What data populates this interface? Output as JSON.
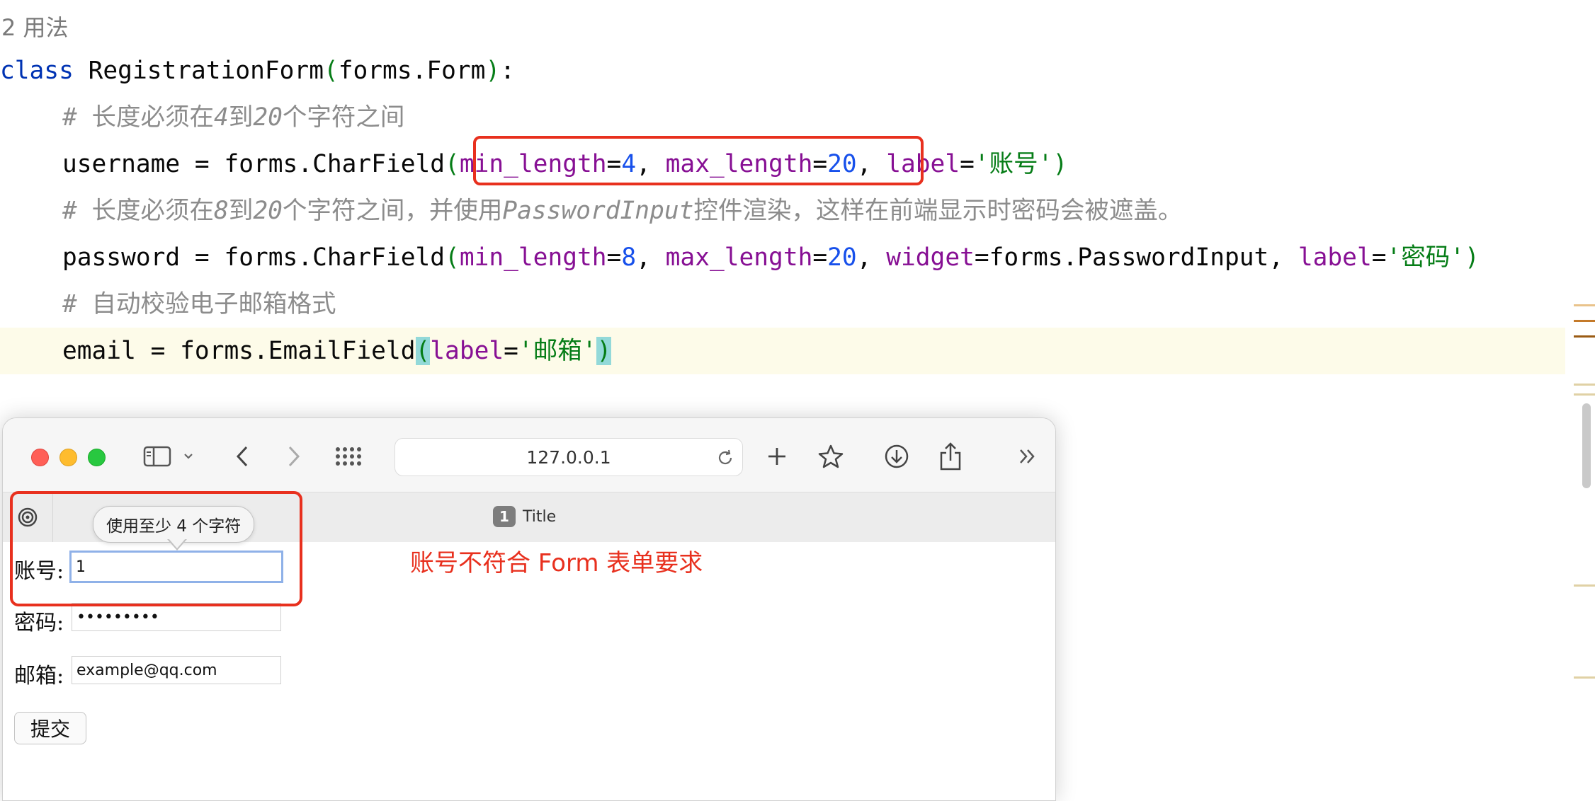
{
  "editor": {
    "usages": "2 用法",
    "line1": {
      "kw": "class",
      "name": " RegistrationForm",
      "open": "(",
      "base": "forms.Form",
      "close": ")",
      "colon": ":"
    },
    "line2": {
      "hash": "# ",
      "text_a": "长度必须在",
      "n1": "4",
      "text_b": "到",
      "n2": "20",
      "text_c": "个字符之间"
    },
    "line3": {
      "lhs": "username = forms.CharField",
      "open": "(",
      "p1": "min_length",
      "eq1": "=",
      "v1": "4",
      "sep1": ", ",
      "p2": "max_length",
      "eq2": "=",
      "v2": "20",
      "sep2": ", ",
      "p3": "label",
      "eq3": "=",
      "v3": "'账号'",
      "close": ")"
    },
    "line4": {
      "hash": "# ",
      "text_a": "长度必须在",
      "n1": "8",
      "text_b": "到",
      "n2": "20",
      "text_c": "个字符之间，并使用",
      "widget": "PasswordInput",
      "text_d": "控件渲染，这样在前端显示时密码会被遮盖。"
    },
    "line5": {
      "lhs": "password = forms.CharField",
      "open": "(",
      "p1": "min_length",
      "eq1": "=",
      "v1": "8",
      "sep1": ", ",
      "p2": "max_length",
      "eq2": "=",
      "v2": "20",
      "sep2": ", ",
      "p3": "widget",
      "eq3": "=",
      "v3": "forms.PasswordInput",
      "sep3": ", ",
      "p4": "label",
      "eq4": "=",
      "v4": "'密码'",
      "close": ")"
    },
    "line6": {
      "hash": "# ",
      "text": "自动校验电子邮箱格式"
    },
    "line7": {
      "lhs": "email = forms.EmailField",
      "open": "(",
      "p1": "label",
      "eq1": "=",
      "v1": "'邮箱'",
      "close": ")"
    }
  },
  "browser": {
    "url": "127.0.0.1",
    "tab": {
      "count": "1",
      "title": "Title"
    },
    "form": {
      "username_label": "账号:",
      "username_value": "1",
      "password_label": "密码:",
      "password_value": "•••••••••",
      "email_label": "邮箱:",
      "email_value": "example@qq.com",
      "submit": "提交"
    },
    "tooltip": "使用至少 4 个字符",
    "annotation": "账号不符合 Form 表单要求"
  },
  "colors": {
    "keyword": "#0033b3",
    "param": "#871094",
    "number": "#1750eb",
    "string": "#067d17",
    "comment": "#8c8c8c",
    "annotation_red": "#e8301e"
  }
}
